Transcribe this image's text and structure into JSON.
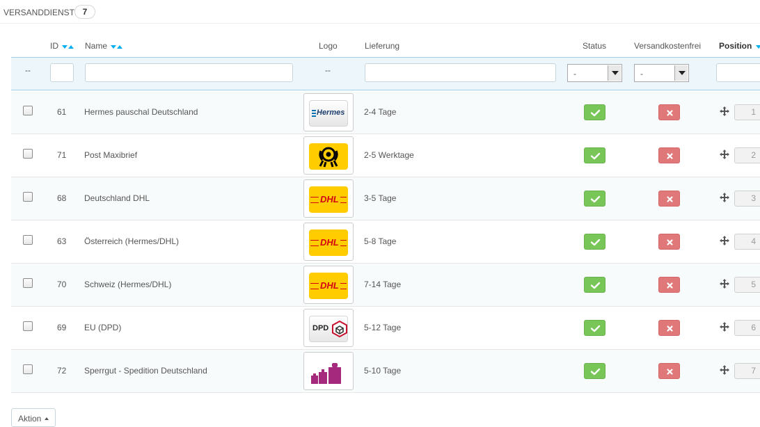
{
  "panel": {
    "title": "VERSANDDIENSTE",
    "count": "7"
  },
  "columns": {
    "id": "ID",
    "name": "Name",
    "logo": "Logo",
    "delivery": "Lieferung",
    "status": "Status",
    "free": "Versandkostenfrei",
    "position": "Position"
  },
  "filters": {
    "checkbox_dash": "--",
    "logo_dash": "--",
    "status_value": "-",
    "free_value": "-"
  },
  "rows": [
    {
      "id": "61",
      "name": "Hermes pauschal Deutschland",
      "delivery": "2-4 Tage",
      "logo": "hermes-logo",
      "logo_text": "Hermes",
      "position": "1"
    },
    {
      "id": "71",
      "name": "Post Maxibrief",
      "delivery": "2-5 Werktage",
      "logo": "deutsche-post-horn-logo",
      "logo_text": "",
      "position": "2"
    },
    {
      "id": "68",
      "name": "Deutschland DHL",
      "delivery": "3-5 Tage",
      "logo": "dhl-logo",
      "logo_text": "DHL",
      "position": "3"
    },
    {
      "id": "63",
      "name": "Österreich (Hermes/DHL)",
      "delivery": "5-8 Tage",
      "logo": "dhl-logo",
      "logo_text": "DHL",
      "position": "4"
    },
    {
      "id": "70",
      "name": "Schweiz (Hermes/DHL)",
      "delivery": "7-14 Tage",
      "logo": "dhl-logo",
      "logo_text": "DHL",
      "position": "5"
    },
    {
      "id": "69",
      "name": "EU (DPD)",
      "delivery": "5-12 Tage",
      "logo": "dpd-logo",
      "logo_text": "DPD",
      "position": "6"
    },
    {
      "id": "72",
      "name": "Sperrgut - Spedition Deutschland",
      "delivery": "5-10 Tage",
      "logo": "weights-icon",
      "logo_text": "",
      "position": "7"
    }
  ],
  "footer": {
    "bulk_action_label": "Aktion"
  },
  "colors": {
    "accent": "#00aff0",
    "enabled": "#78c558",
    "disabled": "#e0787a",
    "dhl_yellow": "#ffcc00",
    "dhl_red": "#d40511"
  }
}
